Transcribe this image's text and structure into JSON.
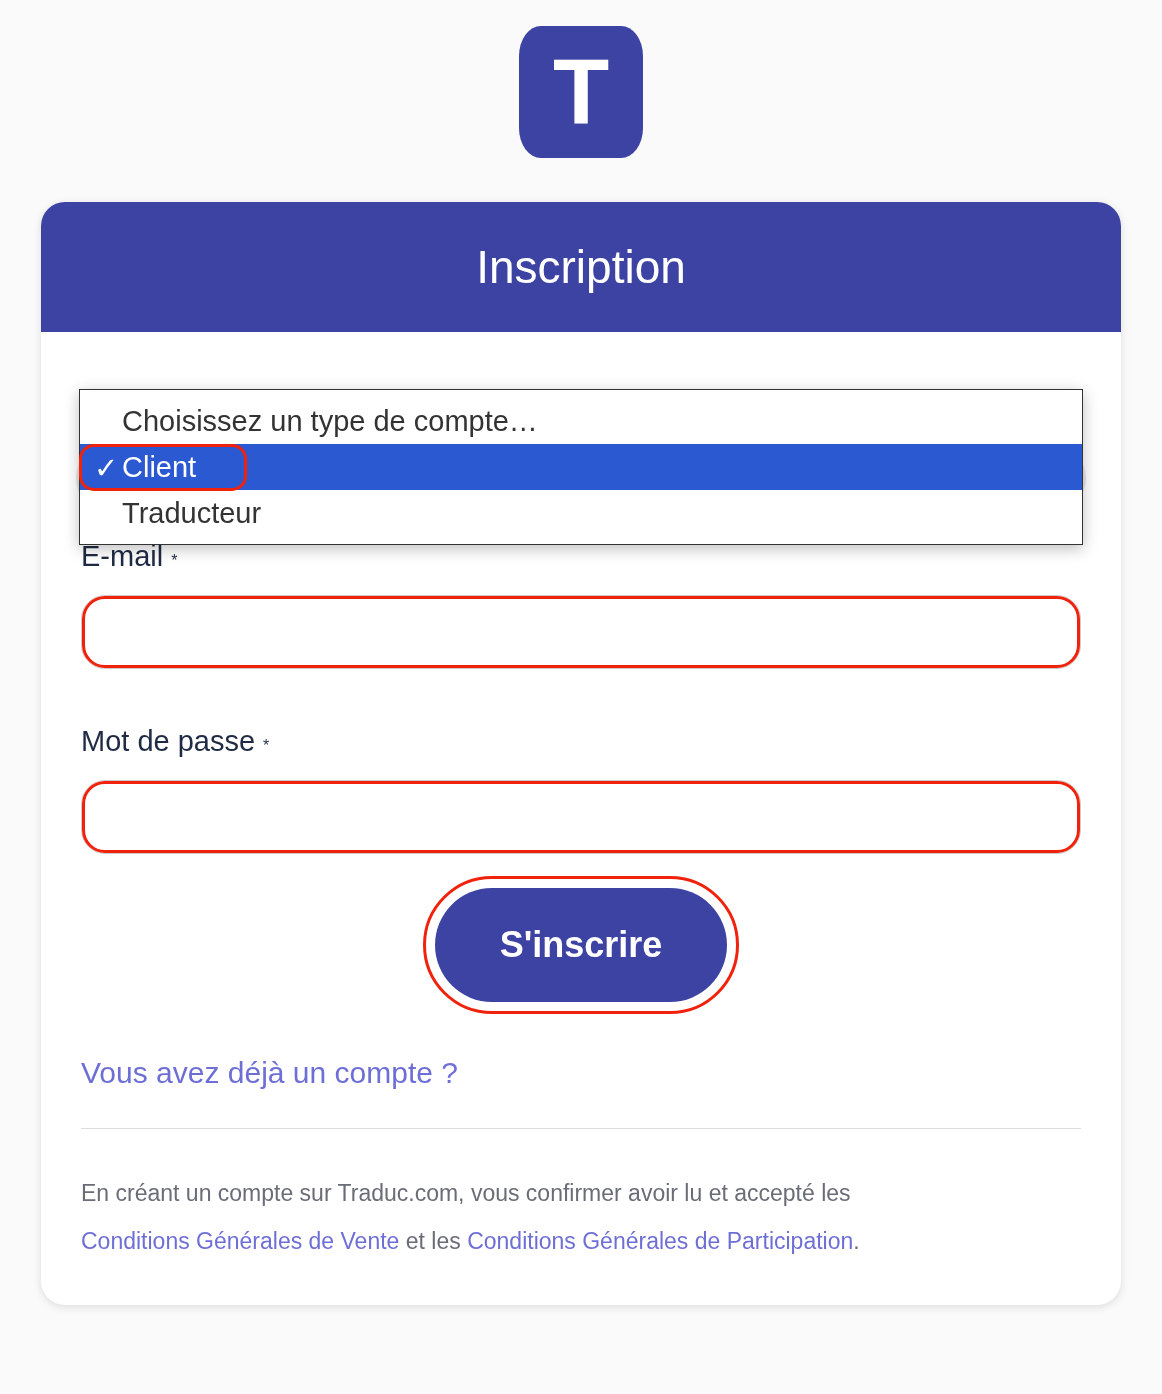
{
  "logo": {
    "letter": "T"
  },
  "header": {
    "title": "Inscription"
  },
  "account_type_dropdown": {
    "options": [
      {
        "label": "Choisissez un type de compte…",
        "selected": false,
        "annotated": false
      },
      {
        "label": "Client",
        "check": "✓",
        "selected": true,
        "annotated": true
      },
      {
        "label": "Traducteur",
        "selected": false,
        "annotated": false
      }
    ]
  },
  "fields": [
    {
      "label": "E-mail",
      "required_mark": "*",
      "annotated": true
    },
    {
      "label": "Mot de passe",
      "required_mark": "*",
      "annotated": true
    }
  ],
  "submit_button": {
    "label": "S'inscrire",
    "annotated": true
  },
  "login_link": "Vous avez déjà un compte ?",
  "footer": {
    "text": "En créant un compte sur Traduc.com, vous confirmer avoir lu et accepté les",
    "link_1": "Conditions Générales de Vente",
    "joiner": "et les",
    "link_2": "Conditions Générales de Participation",
    "end": "."
  }
}
